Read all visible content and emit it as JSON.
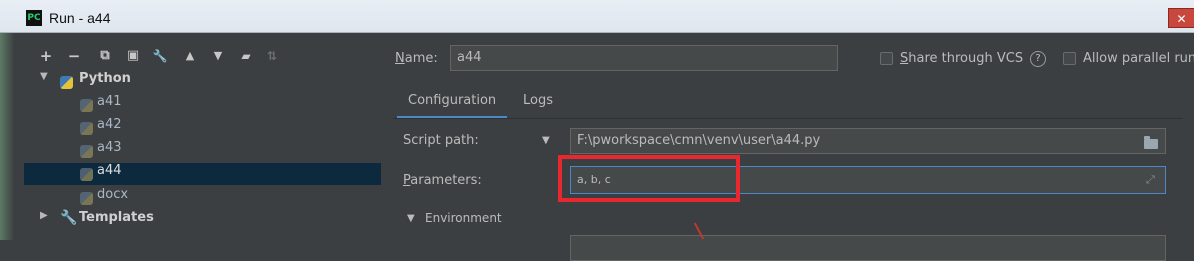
{
  "window": {
    "title": "Run - a44",
    "app_icon": "PC",
    "close_glyph": "✕"
  },
  "toolbar": {
    "buttons": [
      {
        "name": "add-icon",
        "glyph": "+"
      },
      {
        "name": "remove-icon",
        "glyph": "−"
      },
      {
        "name": "copy-icon",
        "glyph": "⧉"
      },
      {
        "name": "save-icon",
        "glyph": "▣"
      },
      {
        "name": "wrench-icon",
        "glyph": "🔧"
      },
      {
        "name": "move-up-icon",
        "glyph": "▲"
      },
      {
        "name": "move-down-icon",
        "glyph": "▼"
      },
      {
        "name": "folder-icon",
        "glyph": "▰"
      },
      {
        "name": "sort-icon",
        "glyph": "⇅"
      }
    ]
  },
  "tree": {
    "python_label": "Python",
    "items": [
      "a41",
      "a42",
      "a43",
      "a44",
      "docx"
    ],
    "selected": "a44",
    "templates_label": "Templates"
  },
  "form": {
    "name_label": "Name:",
    "name_value": "a44",
    "share_label": "Share through VCS",
    "allow_parallel_label": "Allow parallel run",
    "help_glyph": "?",
    "tabs": [
      "Configuration",
      "Logs"
    ],
    "active_tab": "Configuration",
    "script_path_label": "Script path:",
    "script_path_value": "F:\\pworkspace\\cmn\\venv\\user\\a44.py",
    "parameters_label": "Parameters:",
    "parameters_value": "a, b, c",
    "environment_label": "Environment"
  },
  "colors": {
    "background": "#3c3f41",
    "selection": "#0d293e",
    "highlight_box": "#e8282e",
    "tab_underline": "#4a88c7"
  }
}
